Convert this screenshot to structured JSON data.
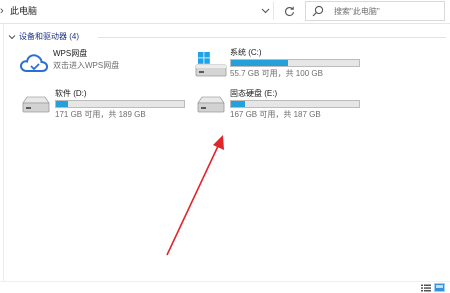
{
  "address_bar": {
    "path": "此电脑",
    "search_placeholder": "搜索\"此电脑\""
  },
  "group": {
    "title": "设备和驱动器 (4)"
  },
  "drives": [
    {
      "name": "WPS网盘",
      "subtitle": "双击进入WPS网盘",
      "icon": "cloud-icon"
    },
    {
      "name": "系统 (C:)",
      "free_text": "55.7 GB 可用，共 100 GB",
      "used_fraction": 0.443,
      "icon": "windows-drive-icon"
    },
    {
      "name": "软件 (D:)",
      "free_text": "171 GB 可用，共 189 GB",
      "used_fraction": 0.095,
      "icon": "hard-drive-icon"
    },
    {
      "name": "固态硬盘 (E:)",
      "free_text": "167 GB 可用，共 187 GB",
      "used_fraction": 0.107,
      "icon": "hard-drive-icon"
    }
  ],
  "colors": {
    "usage_bar": "#26a0da",
    "group_title": "#1e3287",
    "annotation_arrow": "#e0252b"
  }
}
